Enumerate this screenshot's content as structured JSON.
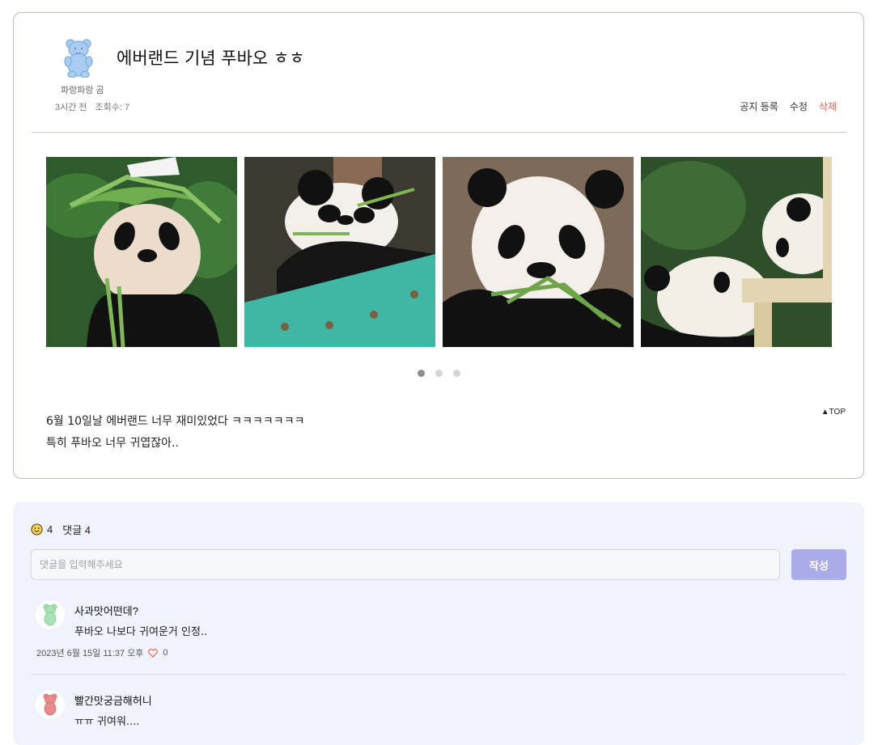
{
  "post": {
    "author": "파랑파랑 곰",
    "title": "에버랜드 기념 푸바오 ㅎㅎ",
    "time_ago": "3시간 전",
    "views": "조회수: 7",
    "actions": {
      "notice": "공지 등록",
      "edit": "수정",
      "delete": "삭제"
    },
    "body_lines": [
      "6월 10일날 에버랜드 너무 재미있었다 ㅋㅋㅋㅋㅋㅋㅋ",
      "특히 푸바오 너무 귀엽잖아.."
    ],
    "top_label": "▲TOP",
    "gallery": {
      "photos": [
        "panda-with-bamboo-hat",
        "panda-eating-bamboo-box",
        "panda-portrait-eating",
        "pandas-playing"
      ],
      "active_page": 1,
      "page_count": 3
    }
  },
  "comments_section": {
    "reaction_count": "4",
    "comment_label": "댓글 4",
    "input_placeholder": "댓글을 입력해주세요",
    "submit_label": "작성",
    "comments": [
      {
        "nick": "사과맛어떤데?",
        "text": "푸바오 나보다 귀여운거 인정..",
        "date": "2023년 6월 15일 11:37 오후",
        "likes": "0",
        "avatar_color": "#a7e3b5"
      },
      {
        "nick": "빨간맛궁금해허니",
        "text": "ㅠㅠ 귀여워....",
        "avatar_color": "#e88b8b"
      }
    ]
  },
  "colors": {
    "accent": "#a9ace8",
    "delete": "#e0624f",
    "panel_bg": "#f1f2fc",
    "avatar_bear": "#a9cdf0"
  }
}
